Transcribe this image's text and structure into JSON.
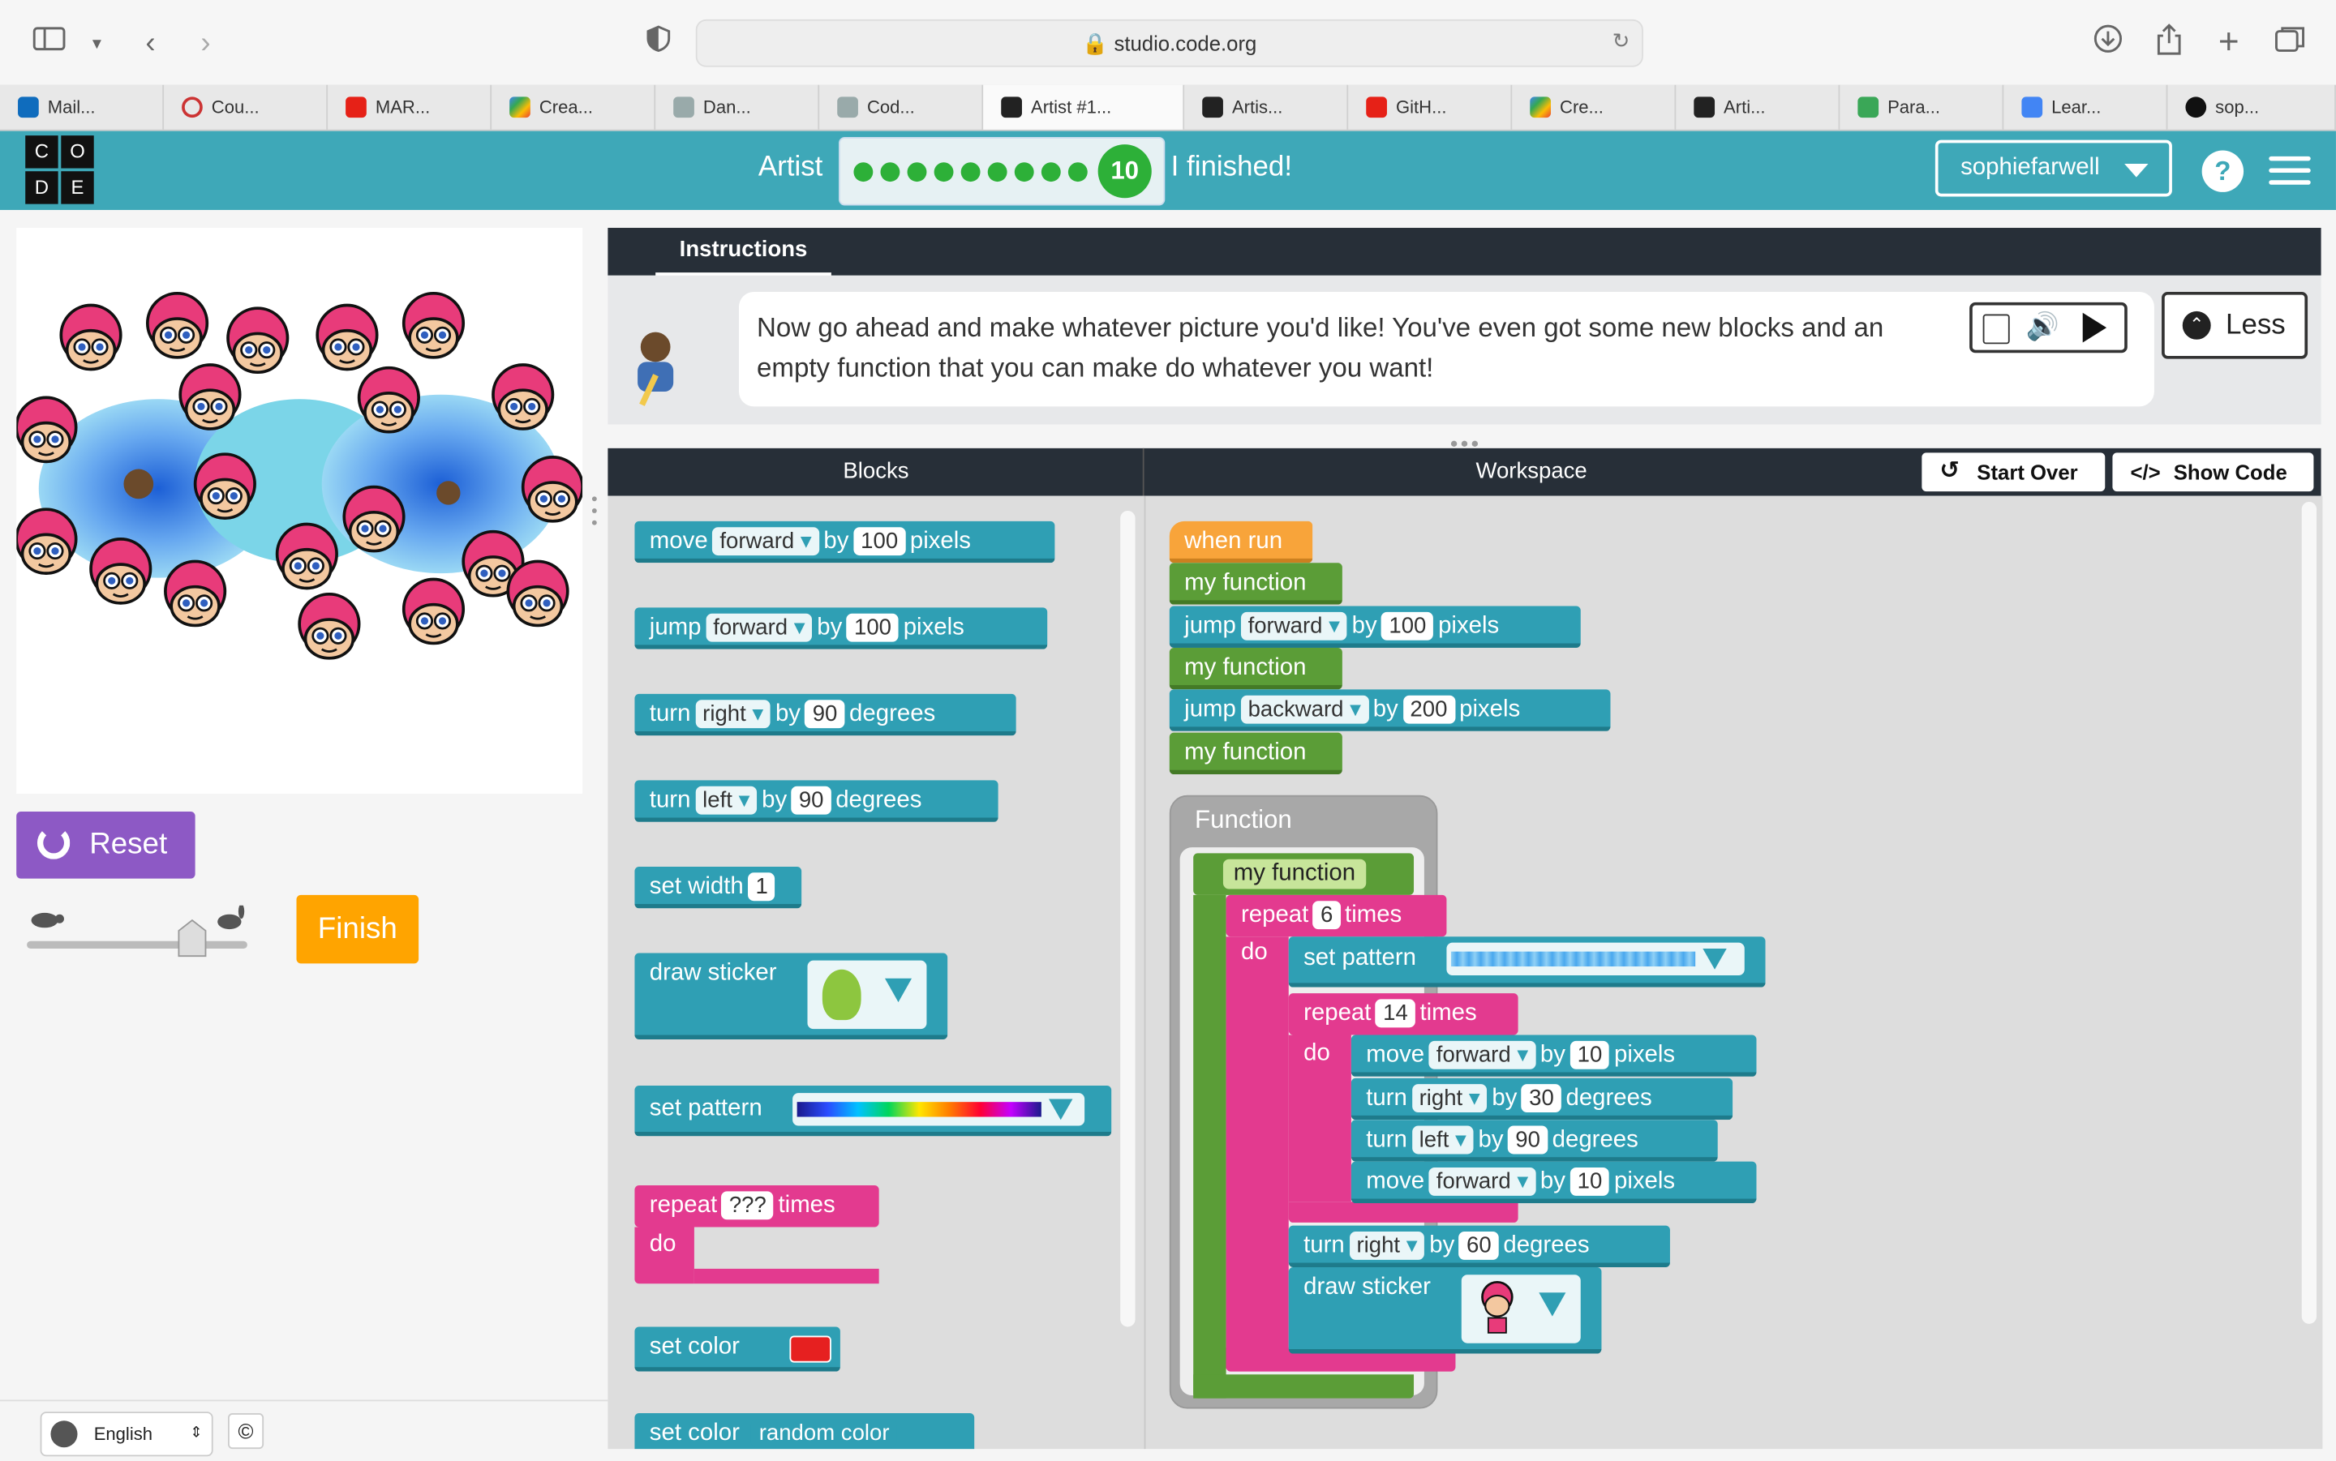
{
  "browser": {
    "url": "studio.code.org",
    "tabs": [
      "Mail...",
      "Cou...",
      "MAR...",
      "Crea...",
      "Dan...",
      "Cod...",
      "Artist #1...",
      "Artis...",
      "GitH...",
      "Cre...",
      "Arti...",
      "Para...",
      "Lear...",
      "sop..."
    ]
  },
  "header": {
    "logo_letters": [
      "C",
      "O",
      "D",
      "E"
    ],
    "level_name": "Artist",
    "level_number": "10",
    "progress_dots_completed": 9,
    "finished_text": "I finished!",
    "user_name": "sophiefarwell",
    "help_symbol": "?"
  },
  "left": {
    "reset_label": "Reset",
    "finish_label": "Finish",
    "language": "English",
    "copyright_symbol": "©"
  },
  "instructions": {
    "tab_label": "Instructions",
    "text": "Now go ahead and make whatever picture you'd like! You've even got some new blocks and an empty function that you can make do whatever you want!",
    "less_label": "Less"
  },
  "panes": {
    "blocks_label": "Blocks",
    "workspace_label": "Workspace",
    "start_over_label": "Start Over",
    "show_code_label": "Show Code"
  },
  "toolbox": {
    "move": {
      "verb": "move",
      "dir": "forward",
      "by": "by",
      "val": "100",
      "unit": "pixels"
    },
    "jump": {
      "verb": "jump",
      "dir": "forward",
      "by": "by",
      "val": "100",
      "unit": "pixels"
    },
    "turn_right": {
      "verb": "turn",
      "dir": "right",
      "by": "by",
      "val": "90",
      "unit": "degrees"
    },
    "turn_left": {
      "verb": "turn",
      "dir": "left",
      "by": "by",
      "val": "90",
      "unit": "degrees"
    },
    "set_width": {
      "label": "set width",
      "val": "1"
    },
    "draw_sticker": {
      "label": "draw sticker"
    },
    "set_pattern": {
      "label": "set pattern"
    },
    "repeat": {
      "label": "repeat",
      "val": "???",
      "unit": "times",
      "do": "do"
    },
    "set_color": {
      "label": "set color"
    },
    "set_color_random": {
      "label": "set color",
      "val": "random color"
    }
  },
  "workspace": {
    "when_run": "when run",
    "my_function": "my function",
    "jump1": {
      "verb": "jump",
      "dir": "forward",
      "by": "by",
      "val": "100",
      "unit": "pixels"
    },
    "jump2": {
      "verb": "jump",
      "dir": "backward",
      "by": "by",
      "val": "200",
      "unit": "pixels"
    },
    "function_label": "Function",
    "def_name": "my function",
    "repeat_outer": {
      "label": "repeat",
      "val": "6",
      "unit": "times",
      "do": "do"
    },
    "set_pattern": "set pattern",
    "repeat_inner": {
      "label": "repeat",
      "val": "14",
      "unit": "times",
      "do": "do"
    },
    "inner_move1": {
      "verb": "move",
      "dir": "forward",
      "by": "by",
      "val": "10",
      "unit": "pixels"
    },
    "inner_turn1": {
      "verb": "turn",
      "dir": "right",
      "by": "by",
      "val": "30",
      "unit": "degrees"
    },
    "inner_turn2": {
      "verb": "turn",
      "dir": "left",
      "by": "by",
      "val": "90",
      "unit": "degrees"
    },
    "inner_move2": {
      "verb": "move",
      "dir": "forward",
      "by": "by",
      "val": "10",
      "unit": "pixels"
    },
    "turn_after": {
      "verb": "turn",
      "dir": "right",
      "by": "by",
      "val": "60",
      "unit": "degrees"
    },
    "draw_sticker": "draw sticker"
  },
  "colors": {
    "header_teal": "#3ea8b8",
    "block_teal": "#2f9fb4",
    "block_green": "#5b9d37",
    "block_orange": "#f8a43a",
    "block_pink": "#e33a8f",
    "reset_purple": "#8d59c5",
    "finish_orange": "#ffa400"
  }
}
